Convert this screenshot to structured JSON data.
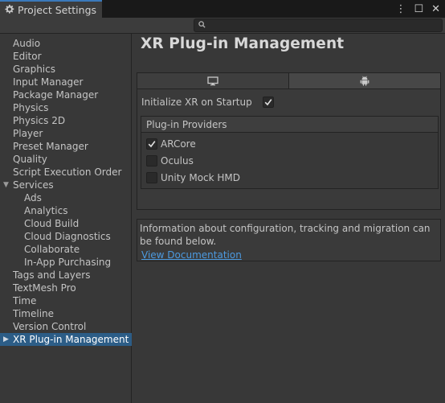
{
  "window": {
    "tab_title": "Project Settings",
    "gear_icon": "gear-icon",
    "controls": [
      "more-vert-icon",
      "maximize-icon",
      "close-icon"
    ],
    "more_glyph": "⋮",
    "max_glyph": "☐",
    "close_glyph": "✕"
  },
  "search": {
    "placeholder": "",
    "value": ""
  },
  "sidebar": {
    "items": [
      {
        "label": "Audio",
        "indent": 0
      },
      {
        "label": "Editor",
        "indent": 0
      },
      {
        "label": "Graphics",
        "indent": 0
      },
      {
        "label": "Input Manager",
        "indent": 0
      },
      {
        "label": "Package Manager",
        "indent": 0
      },
      {
        "label": "Physics",
        "indent": 0
      },
      {
        "label": "Physics 2D",
        "indent": 0
      },
      {
        "label": "Player",
        "indent": 0
      },
      {
        "label": "Preset Manager",
        "indent": 0
      },
      {
        "label": "Quality",
        "indent": 0
      },
      {
        "label": "Script Execution Order",
        "indent": 0
      },
      {
        "label": "Services",
        "indent": 0,
        "expanded": true
      },
      {
        "label": "Ads",
        "indent": 1
      },
      {
        "label": "Analytics",
        "indent": 1
      },
      {
        "label": "Cloud Build",
        "indent": 1
      },
      {
        "label": "Cloud Diagnostics",
        "indent": 1
      },
      {
        "label": "Collaborate",
        "indent": 1
      },
      {
        "label": "In-App Purchasing",
        "indent": 1
      },
      {
        "label": "Tags and Layers",
        "indent": 0
      },
      {
        "label": "TextMesh Pro",
        "indent": 0
      },
      {
        "label": "Time",
        "indent": 0
      },
      {
        "label": "Timeline",
        "indent": 0
      },
      {
        "label": "Version Control",
        "indent": 0
      },
      {
        "label": "XR Plug-in Management",
        "indent": 0,
        "selected": true,
        "collapsed": true
      }
    ]
  },
  "main": {
    "title": "XR Plug-in Management",
    "platform_tabs": [
      {
        "icon": "desktop-icon",
        "active": false
      },
      {
        "icon": "android-icon",
        "active": true
      }
    ],
    "init_label": "Initialize XR on Startup",
    "init_checked": true,
    "providers_title": "Plug-in Providers",
    "providers": [
      {
        "label": "ARCore",
        "checked": true
      },
      {
        "label": "Oculus",
        "checked": false
      },
      {
        "label": "Unity Mock HMD",
        "checked": false
      }
    ],
    "info_text": "Information about configuration, tracking and migration can be found below.",
    "info_link": "View Documentation"
  },
  "colors": {
    "accent": "#3a79bb",
    "selection": "#2c5d87",
    "link": "#4c9ae0"
  }
}
